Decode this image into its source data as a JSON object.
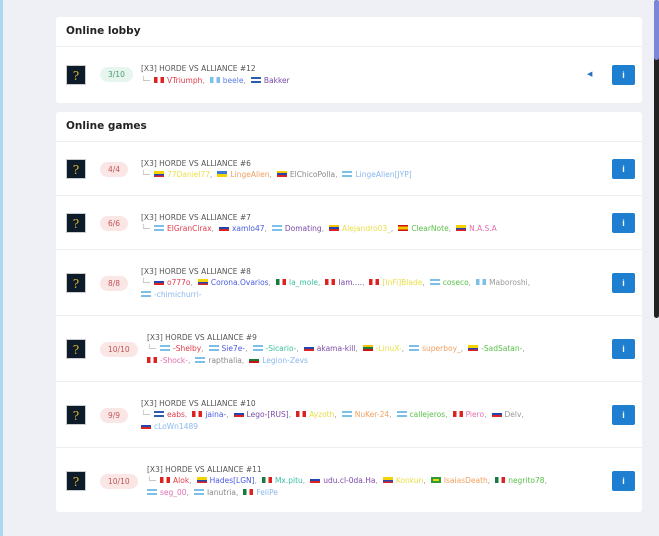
{
  "lobby": {
    "title": "Online lobby",
    "games": [
      {
        "players_count": "3/10",
        "title": "[X3] HORDE VS ALLIANCE #12",
        "players": [
          {
            "name": "VTriumph",
            "flag": "pe",
            "color": "#e03a4a"
          },
          {
            "name": "beele",
            "flag": "gt",
            "color": "#5a7de0"
          },
          {
            "name": "Bakker",
            "flag": "hn",
            "color": "#7a4aa8"
          }
        ]
      }
    ]
  },
  "games": {
    "title": "Online games",
    "list": [
      {
        "players_count": "4/4",
        "title": "[X3] HORDE VS ALLIANCE #6",
        "players": [
          {
            "name": "77Daniel77",
            "flag": "ec",
            "color": "#e8e04a"
          },
          {
            "name": "LingeAlien",
            "flag": "ua",
            "color": "#f0a060"
          },
          {
            "name": "ElChicoPolla",
            "flag": "ve",
            "color": "#888"
          },
          {
            "name": "LingeAlien[JYP]",
            "flag": "ar",
            "color": "#8ab8ee"
          }
        ]
      },
      {
        "players_count": "6/6",
        "title": "[X3] HORDE VS ALLIANCE #7",
        "players": [
          {
            "name": "ElGranCirax",
            "flag": "ar",
            "color": "#e03a4a"
          },
          {
            "name": "xamlo47",
            "flag": "ru",
            "color": "#4a5ae0"
          },
          {
            "name": "Domating",
            "flag": "ar",
            "color": "#7a4aa8"
          },
          {
            "name": "Alejandro03_",
            "flag": "ve",
            "color": "#e8e04a"
          },
          {
            "name": "ClearNote",
            "flag": "es",
            "color": "#5ac04a"
          },
          {
            "name": "N.A.S.A",
            "flag": "co",
            "color": "#e070b0"
          }
        ]
      },
      {
        "players_count": "8/8",
        "title": "[X3] HORDE VS ALLIANCE #8",
        "players": [
          {
            "name": "o777o",
            "flag": "ru",
            "color": "#e03a4a"
          },
          {
            "name": "Corona.Ovarios",
            "flag": "co",
            "color": "#4a5ae0"
          },
          {
            "name": "la_mole",
            "flag": "mx",
            "color": "#3ac0a0"
          },
          {
            "name": "Iam....",
            "flag": "pe",
            "color": "#7a4aa8"
          },
          {
            "name": "[InFi]Blade",
            "flag": "pe",
            "color": "#e8e04a"
          },
          {
            "name": "coseco",
            "flag": "ar",
            "color": "#5ac04a"
          },
          {
            "name": "Maboroshi",
            "flag": "gt",
            "color": "#999"
          },
          {
            "name": "-chimichurri-",
            "flag": "ar",
            "color": "#8ab8ee"
          }
        ]
      },
      {
        "players_count": "10/10",
        "title": "[X3] HORDE VS ALLIANCE #9",
        "players": [
          {
            "name": "-Shelby",
            "flag": "ar",
            "color": "#e03a4a"
          },
          {
            "name": "Sie7e-",
            "flag": "ar",
            "color": "#4a5ae0"
          },
          {
            "name": "-Sicario-",
            "flag": "ar",
            "color": "#3ac0a0"
          },
          {
            "name": "akama-kill",
            "flag": "ru",
            "color": "#7a4aa8"
          },
          {
            "name": "-LinuX-",
            "flag": "lt",
            "color": "#e8e04a"
          },
          {
            "name": "superboy_",
            "flag": "ar",
            "color": "#f0a060"
          },
          {
            "name": "-SadSatan-",
            "flag": "ec",
            "color": "#5ac04a"
          },
          {
            "name": "-Shock-",
            "flag": "pe",
            "color": "#e070b0"
          },
          {
            "name": "rapthalia",
            "flag": "ar",
            "color": "#888"
          },
          {
            "name": "Legion-Zevs",
            "flag": "bg",
            "color": "#8ab8ee"
          }
        ]
      },
      {
        "players_count": "9/9",
        "title": "[X3] HORDE VS ALLIANCE #10",
        "players": [
          {
            "name": "eabs",
            "flag": "hn",
            "color": "#e03a4a"
          },
          {
            "name": "jaina-",
            "flag": "pe",
            "color": "#4a5ae0"
          },
          {
            "name": "Lego-[RUS]",
            "flag": "ru",
            "color": "#7a4aa8"
          },
          {
            "name": "Ayzoth",
            "flag": "pe",
            "color": "#e8e04a"
          },
          {
            "name": "NuKer-24",
            "flag": "ar",
            "color": "#f0a060"
          },
          {
            "name": "callejeros",
            "flag": "ar",
            "color": "#5ac04a"
          },
          {
            "name": "Piero",
            "flag": "pe",
            "color": "#e070b0"
          },
          {
            "name": "Delv",
            "flag": "ru",
            "color": "#999"
          },
          {
            "name": "cLoWn1489",
            "flag": "ru",
            "color": "#8ab8ee"
          }
        ]
      },
      {
        "players_count": "10/10",
        "title": "[X3] HORDE VS ALLIANCE #11",
        "players": [
          {
            "name": "Alok",
            "flag": "pe",
            "color": "#e03a4a"
          },
          {
            "name": "Hades[LGN]",
            "flag": "co",
            "color": "#4a5ae0"
          },
          {
            "name": "Mx.pitu",
            "flag": "mx",
            "color": "#3ac0a0"
          },
          {
            "name": "udu.cl-0da.Ha",
            "flag": "ru",
            "color": "#7a4aa8"
          },
          {
            "name": "Konkun",
            "flag": "ec",
            "color": "#e8e04a"
          },
          {
            "name": "IsaiasDeath",
            "flag": "br",
            "color": "#f0a060"
          },
          {
            "name": "negrito78",
            "flag": "mx",
            "color": "#5ac04a"
          },
          {
            "name": "seg_00",
            "flag": "ar",
            "color": "#e070b0"
          },
          {
            "name": "Ianutria",
            "flag": "ar",
            "color": "#888"
          },
          {
            "name": "FeliPe",
            "flag": "mx",
            "color": "#8ab8ee"
          }
        ]
      }
    ]
  },
  "icons": {
    "info": "i",
    "map": "?",
    "tree": "└─",
    "sound": "◀"
  }
}
